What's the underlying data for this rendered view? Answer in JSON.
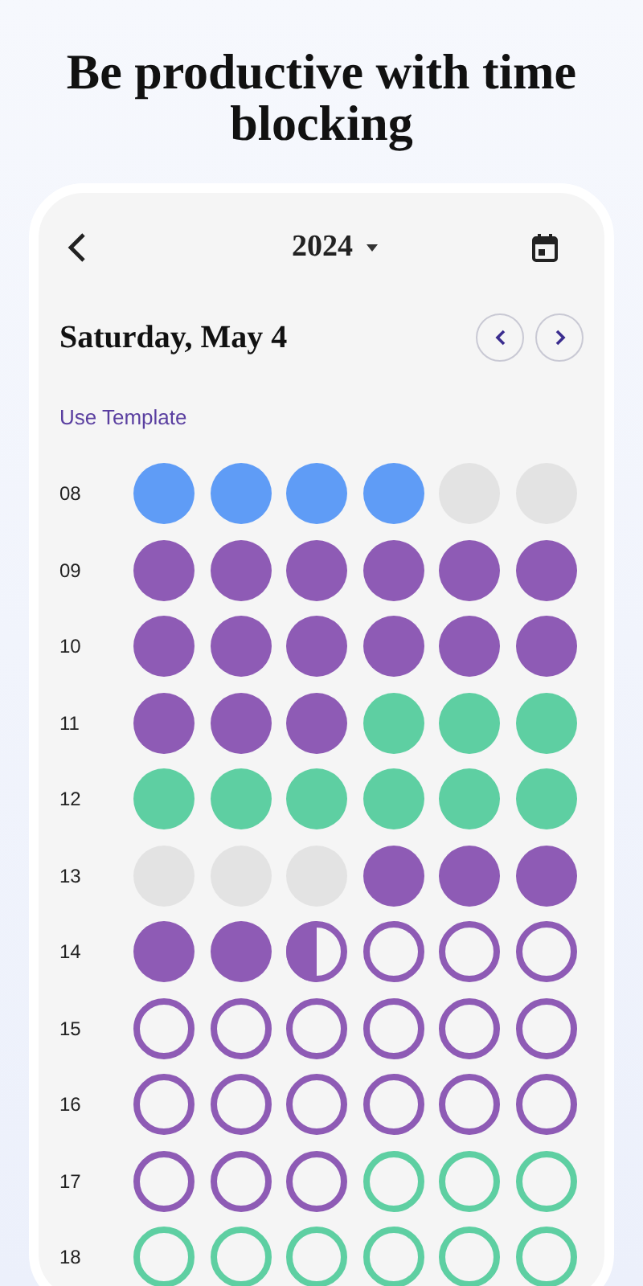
{
  "headline": "Be productive with time blocking",
  "year": "2024",
  "date": "Saturday, May 4",
  "template_link": "Use Template",
  "rows": [
    {
      "hour": "08",
      "cells": [
        {
          "kind": "filled",
          "color": "#5f9cf6"
        },
        {
          "kind": "filled",
          "color": "#5f9cf6"
        },
        {
          "kind": "filled",
          "color": "#5f9cf6"
        },
        {
          "kind": "filled",
          "color": "#5f9cf6"
        },
        {
          "kind": "filled",
          "color": "#e3e3e3"
        },
        {
          "kind": "filled",
          "color": "#e3e3e3"
        }
      ]
    },
    {
      "hour": "09",
      "cells": [
        {
          "kind": "filled",
          "color": "#8e5bb5"
        },
        {
          "kind": "filled",
          "color": "#8e5bb5"
        },
        {
          "kind": "filled",
          "color": "#8e5bb5"
        },
        {
          "kind": "filled",
          "color": "#8e5bb5"
        },
        {
          "kind": "filled",
          "color": "#8e5bb5"
        },
        {
          "kind": "filled",
          "color": "#8e5bb5"
        }
      ]
    },
    {
      "hour": "10",
      "cells": [
        {
          "kind": "filled",
          "color": "#8e5bb5"
        },
        {
          "kind": "filled",
          "color": "#8e5bb5"
        },
        {
          "kind": "filled",
          "color": "#8e5bb5"
        },
        {
          "kind": "filled",
          "color": "#8e5bb5"
        },
        {
          "kind": "filled",
          "color": "#8e5bb5"
        },
        {
          "kind": "filled",
          "color": "#8e5bb5"
        }
      ]
    },
    {
      "hour": "11",
      "cells": [
        {
          "kind": "filled",
          "color": "#8e5bb5"
        },
        {
          "kind": "filled",
          "color": "#8e5bb5"
        },
        {
          "kind": "filled",
          "color": "#8e5bb5"
        },
        {
          "kind": "filled",
          "color": "#5ecfa2"
        },
        {
          "kind": "filled",
          "color": "#5ecfa2"
        },
        {
          "kind": "filled",
          "color": "#5ecfa2"
        }
      ]
    },
    {
      "hour": "12",
      "cells": [
        {
          "kind": "filled",
          "color": "#5ecfa2"
        },
        {
          "kind": "filled",
          "color": "#5ecfa2"
        },
        {
          "kind": "filled",
          "color": "#5ecfa2"
        },
        {
          "kind": "filled",
          "color": "#5ecfa2"
        },
        {
          "kind": "filled",
          "color": "#5ecfa2"
        },
        {
          "kind": "filled",
          "color": "#5ecfa2"
        }
      ]
    },
    {
      "hour": "13",
      "cells": [
        {
          "kind": "filled",
          "color": "#e3e3e3"
        },
        {
          "kind": "filled",
          "color": "#e3e3e3"
        },
        {
          "kind": "filled",
          "color": "#e3e3e3"
        },
        {
          "kind": "filled",
          "color": "#8e5bb5"
        },
        {
          "kind": "filled",
          "color": "#8e5bb5"
        },
        {
          "kind": "filled",
          "color": "#8e5bb5"
        }
      ]
    },
    {
      "hour": "14",
      "cells": [
        {
          "kind": "filled",
          "color": "#8e5bb5"
        },
        {
          "kind": "filled",
          "color": "#8e5bb5"
        },
        {
          "kind": "half",
          "color": "#8e5bb5"
        },
        {
          "kind": "outline",
          "color": "#8e5bb5"
        },
        {
          "kind": "outline",
          "color": "#8e5bb5"
        },
        {
          "kind": "outline",
          "color": "#8e5bb5"
        }
      ]
    },
    {
      "hour": "15",
      "cells": [
        {
          "kind": "outline",
          "color": "#8e5bb5"
        },
        {
          "kind": "outline",
          "color": "#8e5bb5"
        },
        {
          "kind": "outline",
          "color": "#8e5bb5"
        },
        {
          "kind": "outline",
          "color": "#8e5bb5"
        },
        {
          "kind": "outline",
          "color": "#8e5bb5"
        },
        {
          "kind": "outline",
          "color": "#8e5bb5"
        }
      ]
    },
    {
      "hour": "16",
      "cells": [
        {
          "kind": "outline",
          "color": "#8e5bb5"
        },
        {
          "kind": "outline",
          "color": "#8e5bb5"
        },
        {
          "kind": "outline",
          "color": "#8e5bb5"
        },
        {
          "kind": "outline",
          "color": "#8e5bb5"
        },
        {
          "kind": "outline",
          "color": "#8e5bb5"
        },
        {
          "kind": "outline",
          "color": "#8e5bb5"
        }
      ]
    },
    {
      "hour": "17",
      "cells": [
        {
          "kind": "outline",
          "color": "#8e5bb5"
        },
        {
          "kind": "outline",
          "color": "#8e5bb5"
        },
        {
          "kind": "outline",
          "color": "#8e5bb5"
        },
        {
          "kind": "outline",
          "color": "#5ecfa2"
        },
        {
          "kind": "outline",
          "color": "#5ecfa2"
        },
        {
          "kind": "outline",
          "color": "#5ecfa2"
        }
      ]
    },
    {
      "hour": "18",
      "cells": [
        {
          "kind": "outline",
          "color": "#5ecfa2"
        },
        {
          "kind": "outline",
          "color": "#5ecfa2"
        },
        {
          "kind": "outline",
          "color": "#5ecfa2"
        },
        {
          "kind": "outline",
          "color": "#5ecfa2"
        },
        {
          "kind": "outline",
          "color": "#5ecfa2"
        },
        {
          "kind": "outline",
          "color": "#5ecfa2"
        }
      ]
    }
  ]
}
